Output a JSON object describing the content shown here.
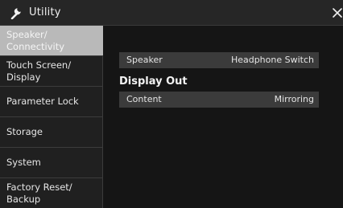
{
  "window": {
    "title": "Utility",
    "title_icon": "wrench-icon",
    "close_icon": "close-icon"
  },
  "sidebar": {
    "items": [
      {
        "label": "Speaker/\nConnectivity",
        "active": true
      },
      {
        "label": "Touch Screen/\nDisplay",
        "active": false
      },
      {
        "label": "Parameter Lock",
        "active": false
      },
      {
        "label": "Storage",
        "active": false
      },
      {
        "label": "System",
        "active": false
      },
      {
        "label": "Factory Reset/\nBackup",
        "active": false
      }
    ]
  },
  "main": {
    "speaker_row": {
      "label": "Speaker",
      "value": "Headphone Switch"
    },
    "display_out": {
      "heading": "Display Out",
      "content_row": {
        "label": "Content",
        "value": "Mirroring"
      }
    }
  },
  "colors": {
    "background": "#1c1c1c",
    "sidebar_active": "#b9b9b9",
    "row_background": "#3b3b3b"
  }
}
